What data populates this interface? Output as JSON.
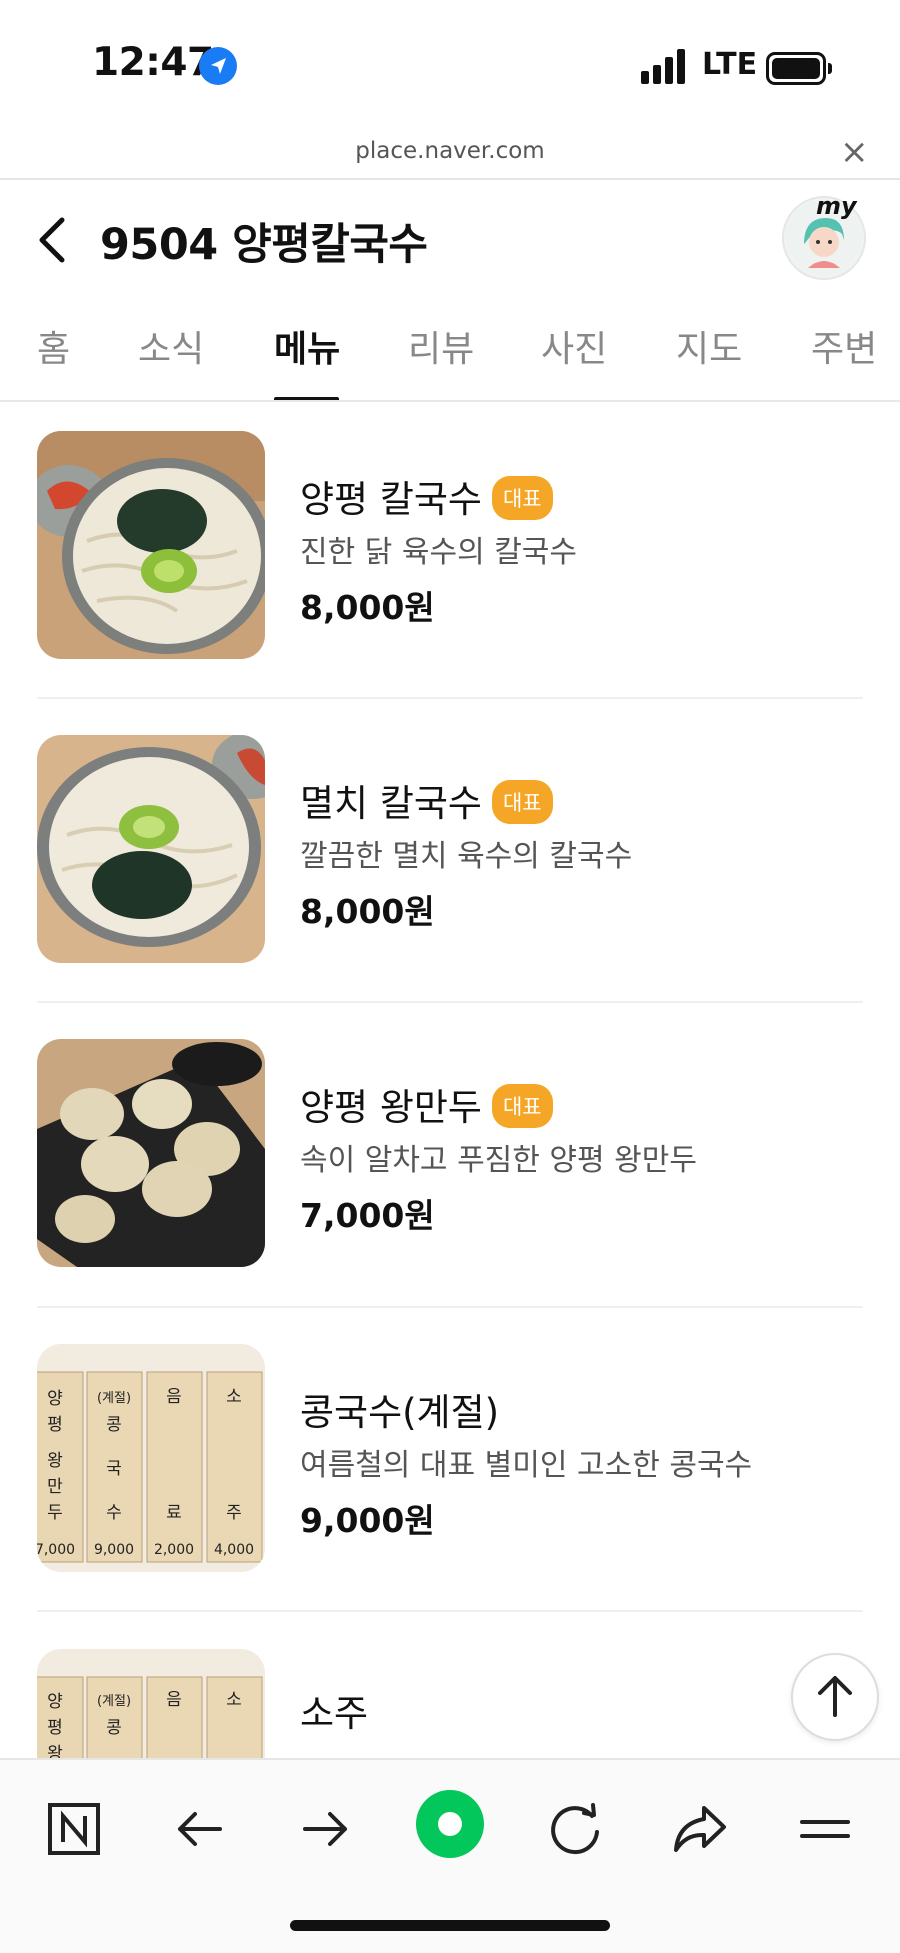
{
  "status_bar": {
    "time": "12:47",
    "network": "LTE"
  },
  "browser": {
    "url": "place.naver.com"
  },
  "header": {
    "title": "9504 양평칼국수",
    "profile_label": "my"
  },
  "tabs": [
    {
      "label": "홈"
    },
    {
      "label": "소식"
    },
    {
      "label": "메뉴"
    },
    {
      "label": "리뷰"
    },
    {
      "label": "사진"
    },
    {
      "label": "지도"
    },
    {
      "label": "주변"
    }
  ],
  "active_tab": "메뉴",
  "menu": [
    {
      "name": "양평 칼국수",
      "badge": "대표",
      "description": "진한 닭 육수의 칼국수",
      "price": "8,000원"
    },
    {
      "name": "멸치 칼국수",
      "badge": "대표",
      "description": "깔끔한 멸치 육수의 칼국수",
      "price": "8,000원"
    },
    {
      "name": "양평 왕만두",
      "badge": "대표",
      "description": "속이 알차고 푸짐한 양평 왕만두",
      "price": "7,000원"
    },
    {
      "name": "콩국수(계절)",
      "description": "여름철의 대표 별미인 고소한 콩국수",
      "price": "9,000원"
    },
    {
      "name": "소주"
    }
  ],
  "menu_board": [
    {
      "tag": "",
      "text": "양평왕만두",
      "price": "7,000"
    },
    {
      "tag": "(계절)",
      "text": "콩국수",
      "price": "9,000"
    },
    {
      "tag": "",
      "text": "음료",
      "price": "2,000"
    },
    {
      "tag": "",
      "text": "소주",
      "price": "4,000"
    }
  ],
  "menu_board_short": [
    {
      "tag": "",
      "text": "양평왕"
    },
    {
      "tag": "(계절)",
      "text": "콩"
    },
    {
      "tag": "",
      "text": "음"
    },
    {
      "tag": "",
      "text": "소"
    }
  ],
  "colors": {
    "badge": "#f6a626",
    "naver_green": "#03c75a",
    "active_tab": "#111111"
  },
  "icons": [
    "location-arrow-icon",
    "signal-icon",
    "battery-icon",
    "close-icon",
    "back-icon",
    "naver-n-icon",
    "arrow-left-icon",
    "arrow-right-icon",
    "naver-green-icon",
    "refresh-icon",
    "share-icon",
    "menu-icon",
    "arrow-up-icon"
  ]
}
